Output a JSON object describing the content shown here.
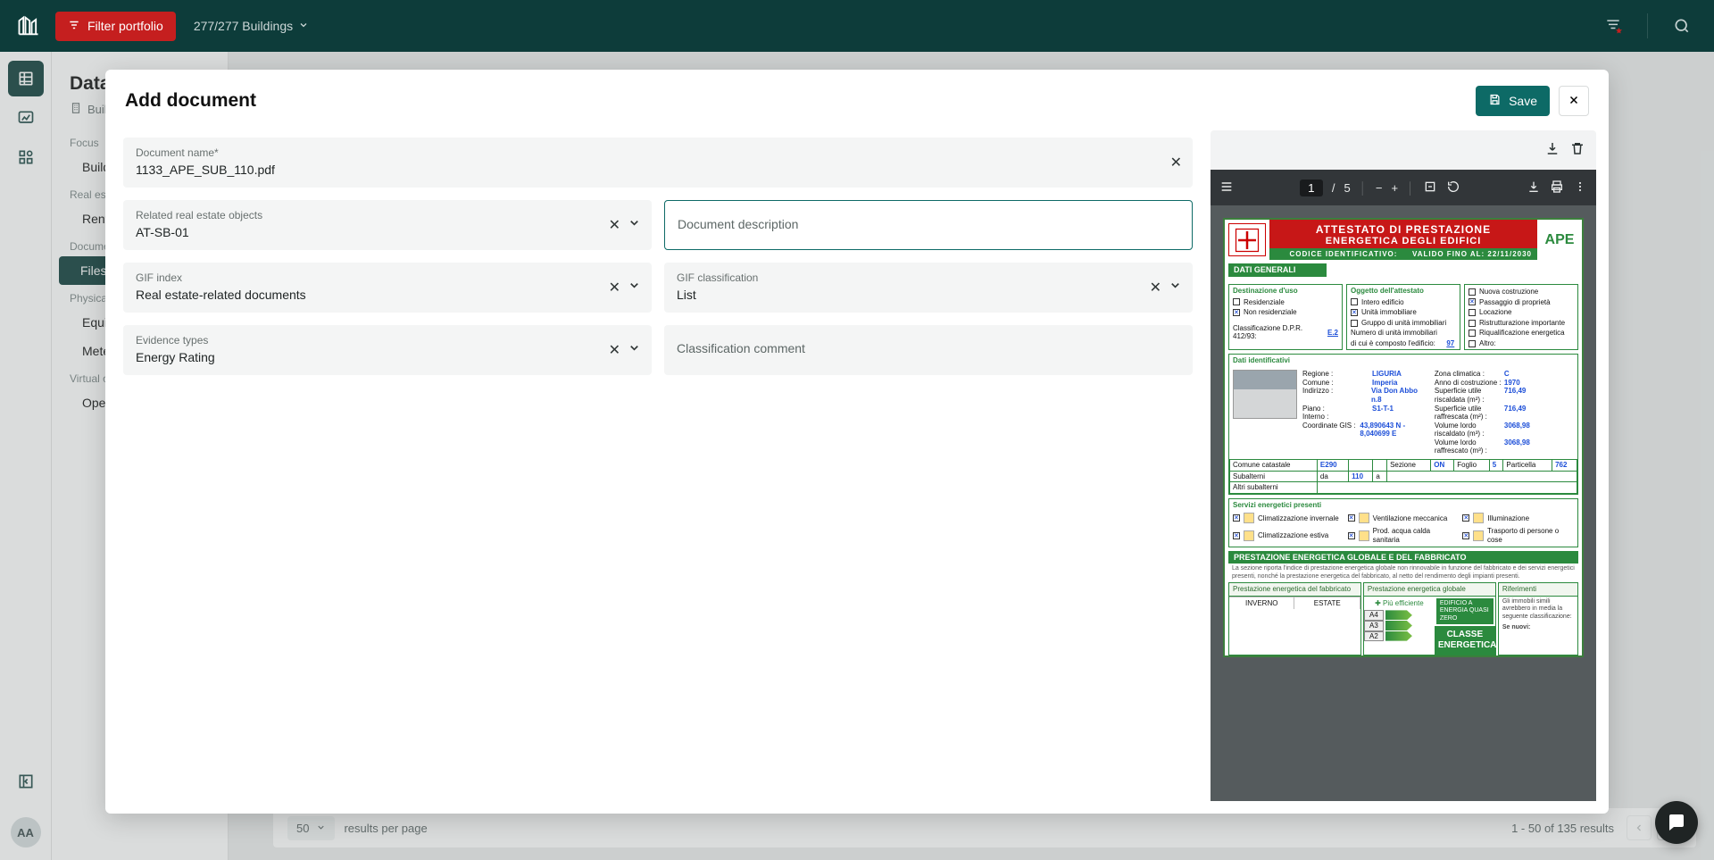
{
  "banner": {
    "filter_label": "Filter portfolio",
    "buildings_count": "277/277 Buildings"
  },
  "avatar_initials": "AA",
  "sidebar": {
    "page_title": "Data",
    "breadcrumb": "Buildings",
    "groups": [
      {
        "heading": "Focus",
        "items": [
          "Buildings"
        ]
      },
      {
        "heading": "Real estate",
        "items": [
          "Rent"
        ]
      },
      {
        "heading": "Documents",
        "items": [
          "Files"
        ]
      },
      {
        "heading": "Physical objects",
        "items": [
          "Equipment",
          "Meters"
        ]
      },
      {
        "heading": "Virtual objects",
        "items": [
          "Operations"
        ]
      }
    ],
    "active_item": "Files"
  },
  "modal": {
    "title": "Add document",
    "save_label": "Save",
    "fields": {
      "doc_name": {
        "label": "Document name*",
        "value": "1133_APE_SUB_110.pdf"
      },
      "related": {
        "label": "Related real estate objects",
        "value": "AT-SB-01"
      },
      "description": {
        "label": "Document description",
        "value": ""
      },
      "gif_index": {
        "label": "GIF index",
        "value": "Real estate-related documents"
      },
      "gif_class": {
        "label": "GIF classification",
        "value": "List"
      },
      "evidence": {
        "label": "Evidence types",
        "value": "Energy Rating"
      },
      "class_comment": {
        "label": "Classification comment",
        "value": ""
      }
    }
  },
  "pdf_viewer": {
    "current_page": "1",
    "total_pages": "5"
  },
  "ape_doc": {
    "title1": "ATTESTATO DI PRESTAZIONE",
    "title2": "ENERGETICA DEGLI EDIFICI",
    "logo_text": "APE",
    "codice": "CODICE IDENTIFICATIVO:",
    "valido": "VALIDO FINO AL: 22/11/2030",
    "dati_generali": "DATI GENERALI",
    "dest_hd": "Destinazione d'uso",
    "dest_items": [
      {
        "label": "Residenziale",
        "checked": false
      },
      {
        "label": "Non residenziale",
        "checked": true
      }
    ],
    "classificazione": "Classificazione D.P.R. 412/93:",
    "classificazione_val": "E.2",
    "oggetto_hd": "Oggetto dell'attestato",
    "oggetto_items": [
      {
        "label": "Intero edificio",
        "checked": false
      },
      {
        "label": "Unità immobiliare",
        "checked": true
      },
      {
        "label": "Gruppo di unità immobiliari",
        "checked": false
      }
    ],
    "num_unita_label": "Numero di unità immobiliari",
    "num_unita_sub": "di cui è composto l'edificio:",
    "num_unita_val": "97",
    "motiv_items": [
      {
        "label": "Nuova costruzione",
        "checked": false
      },
      {
        "label": "Passaggio di proprietà",
        "checked": true
      },
      {
        "label": "Locazione",
        "checked": false
      },
      {
        "label": "Ristrutturazione importante",
        "checked": false
      },
      {
        "label": "Riqualificazione energetica",
        "checked": false
      },
      {
        "label": "Altro:",
        "checked": false
      }
    ],
    "dati_id_hd": "Dati identificativi",
    "kv_left": [
      {
        "lab": "Regione :",
        "val": "LIGURIA"
      },
      {
        "lab": "Comune :",
        "val": "Imperia"
      },
      {
        "lab": "Indirizzo :",
        "val": "Via Don Abbo n.8"
      },
      {
        "lab": "Piano :",
        "val": "S1-T-1"
      },
      {
        "lab": "Interno :",
        "val": ""
      },
      {
        "lab": "Coordinate GIS :",
        "val": "43,890643 N - 8,040699 E"
      }
    ],
    "kv_right": [
      {
        "lab": "Zona climatica :",
        "val": "C"
      },
      {
        "lab": "Anno di costruzione :",
        "val": "1970"
      },
      {
        "lab": "Superficie utile riscaldata (m²) :",
        "val": "716,49"
      },
      {
        "lab": "Superficie utile raffrescata (m²) :",
        "val": "716,49"
      },
      {
        "lab": "Volume lordo riscaldato (m³) :",
        "val": "3068,98"
      },
      {
        "lab": "Volume lordo raffrescato (m³) :",
        "val": "3068,98"
      }
    ],
    "cat_row": {
      "comune_cat": "Comune catastale",
      "comune_val": "E290",
      "sezione": "Sezione",
      "sezione_val": "ON",
      "foglio": "Foglio",
      "foglio_val": "5",
      "particella": "Particella",
      "particella_val": "762"
    },
    "sub_row": {
      "l1": "Subalterni",
      "da": "da",
      "da_v": "110",
      "a": "a",
      "altri": "Altri subalterni"
    },
    "serv_hd": "Servizi energetici presenti",
    "serv_items": [
      [
        "Climatizzazione invernale",
        "Ventilazione meccanica",
        "Illuminazione"
      ],
      [
        "Climatizzazione estiva",
        "Prod. acqua calda sanitaria",
        "Trasporto di persone o cose"
      ]
    ],
    "perf_hd": "PRESTAZIONE ENERGETICA GLOBALE E DEL FABBRICATO",
    "perf_note": "La sezione riporta l'indice di prestazione energetica globale non rinnovabile in funzione del fabbricato e dei servizi energetici presenti, nonché la prestazione energetica del fabbricato, al netto del rendimento degli impianti presenti.",
    "perf_col1": "Prestazione energetica del fabbricato",
    "perf_col2": "Prestazione energetica globale",
    "perf_col3": "Riferimenti",
    "inverno": "INVERNO",
    "estate": "ESTATE",
    "piu_eff": "✚ Più efficiente",
    "ratings": [
      "A4",
      "A3",
      "A2"
    ],
    "zero": "EDIFICIO A ENERGIA QUASI ZERO",
    "classe": "CLASSE ENERGETICA",
    "rif_text": "Gli immobili simili avrebbero in media la seguente classificazione:",
    "se_nuovi": "Se nuovi:"
  },
  "pagination": {
    "per_page": "50",
    "per_page_label": "results per page",
    "summary": "1 - 50 of  135 results"
  }
}
